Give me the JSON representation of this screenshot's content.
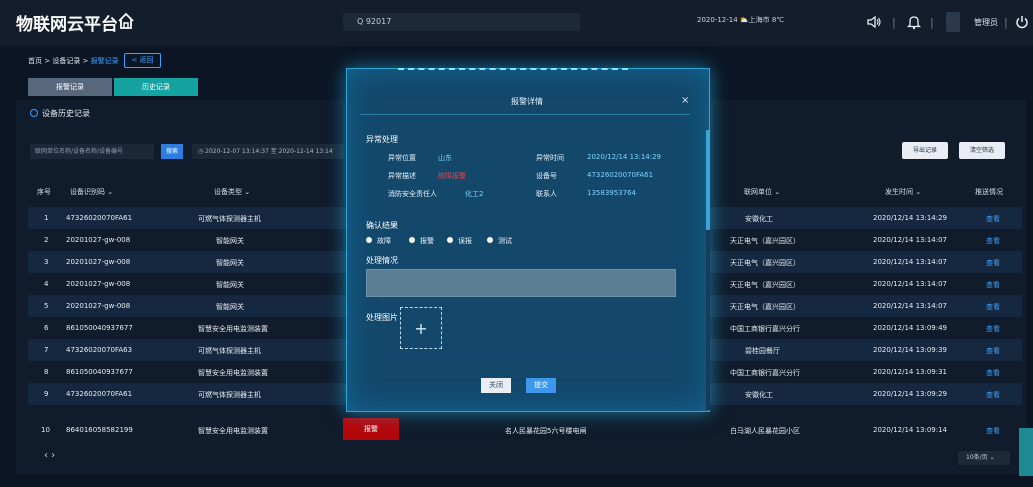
{
  "header": {
    "app_title": "物联网云平台",
    "search_value": "Q 92017",
    "datetime_weather": "2020-12-14  ⛅上海市 8℃",
    "user_name": "管理员"
  },
  "breadcrumb": {
    "home": "首页",
    "level2": "设备记录",
    "current": "报警记录",
    "sep": " > "
  },
  "back_button": "< 返回",
  "tabs": [
    "报警记录",
    "历史记录"
  ],
  "panel": {
    "title": "设备历史记录",
    "filter_placeholder": "联网单位名称/设备名称/设备编号",
    "filter_button": "搜索",
    "date_range": "◷ 2020-12-07 13:14:37  至  2020-12-14 13:14",
    "export_button": "导出记录",
    "clear_button": "清空筛选"
  },
  "table": {
    "headers": {
      "idx": "序号",
      "device_id": "设备识别码 ⌄",
      "device_type": "设备类型 ⌄",
      "unit": "联网单位 ⌄",
      "time": "发生时间 ⌄",
      "handled": "推送情况"
    },
    "rows": [
      {
        "idx": "1",
        "device_id": "47326020070FA61",
        "device_type": "可燃气体探测器主机",
        "unit": "安徽化工",
        "time": "2020/12/14 13:14:29",
        "view": "查看"
      },
      {
        "idx": "2",
        "device_id": "20201027-gw-008",
        "device_type": "智能网关",
        "unit": "天正电气（嘉兴园区）",
        "time": "2020/12/14 13:14:07",
        "view": "查看"
      },
      {
        "idx": "3",
        "device_id": "20201027-gw-008",
        "device_type": "智能网关",
        "unit": "天正电气（嘉兴园区）",
        "time": "2020/12/14 13:14:07",
        "view": "查看"
      },
      {
        "idx": "4",
        "device_id": "20201027-gw-008",
        "device_type": "智能网关",
        "unit": "天正电气（嘉兴园区）",
        "time": "2020/12/14 13:14:07",
        "view": "查看"
      },
      {
        "idx": "5",
        "device_id": "20201027-gw-008",
        "device_type": "智能网关",
        "unit": "天正电气（嘉兴园区）",
        "time": "2020/12/14 13:14:07",
        "view": "查看"
      },
      {
        "idx": "6",
        "device_id": "861050040937677",
        "device_type": "智慧安全用电监测装置",
        "unit": "中国工商银行嘉兴分行",
        "time": "2020/12/14 13:09:49",
        "view": "查看"
      },
      {
        "idx": "7",
        "device_id": "47326020070FA63",
        "device_type": "可燃气体探测器主机",
        "unit": "碧桂园餐厅",
        "time": "2020/12/14 13:09:39",
        "view": "查看"
      },
      {
        "idx": "8",
        "device_id": "861050040937677",
        "device_type": "智慧安全用电监测装置",
        "unit": "中国工商银行嘉兴分行",
        "time": "2020/12/14 13:09:31",
        "view": "查看"
      },
      {
        "idx": "9",
        "device_id": "47326020070FA61",
        "device_type": "可燃气体探测器主机",
        "unit": "安徽化工",
        "time": "2020/12/14 13:09:29",
        "view": "查看"
      },
      {
        "idx": "10",
        "device_id": "864016058582199",
        "device_type": "智慧安全用电监测装置",
        "unit": "白马湖人民暴花园小区",
        "time": "2020/12/14 13:09:14",
        "view": "查看"
      }
    ],
    "row10_status": "报警",
    "row10_location": "名人民暴花园5六号楼电闸"
  },
  "pagination": {
    "nav": "‹   ›",
    "page_size": "10条/页 ⌄"
  },
  "modal": {
    "title": "报警详情",
    "close": "×",
    "section_abnormal": "异常处理",
    "location_label": "异常位置",
    "location_value": "山东",
    "desc_label": "异常描述",
    "desc_value": "故障报警",
    "responsible_label": "消防安全责任人",
    "responsible_value": "化工2",
    "time_label": "异常时间",
    "time_value": "2020/12/14 13:14:29",
    "device_label": "设备号",
    "device_value": "47326020070FA61",
    "contact_label": "联系人",
    "contact_value": "13583953764",
    "section_confirm": "确认结果",
    "radio_options": [
      "故障",
      "报警",
      "误报",
      "测试"
    ],
    "section_handling": "处理情况",
    "section_images": "处理图片",
    "upload_plus": "+",
    "btn_close": "关闭",
    "btn_submit": "提交"
  },
  "colors": {
    "accent": "#3ba2ff",
    "teal": "#15a3a2",
    "alarm": "#b4070a"
  }
}
